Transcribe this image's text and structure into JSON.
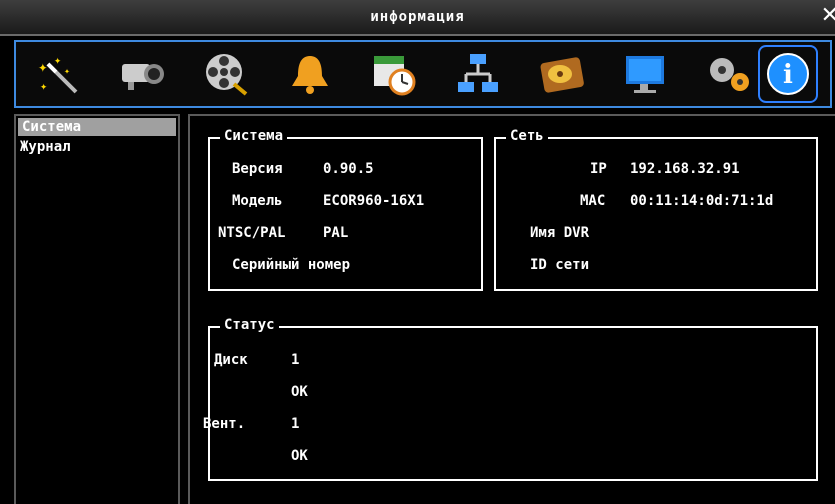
{
  "window": {
    "title": "информация"
  },
  "toolbar": {
    "icons": [
      "wizard-icon",
      "camera-icon",
      "film-reel-icon",
      "alarm-bell-icon",
      "schedule-icon",
      "network-icon",
      "hdd-icon",
      "monitor-icon",
      "settings-gears-icon",
      "info-icon"
    ],
    "selected": "info-icon"
  },
  "leftnav": {
    "items": [
      {
        "label": "Система",
        "active": true
      },
      {
        "label": "Журнал",
        "active": false
      }
    ]
  },
  "system_group": {
    "title": "Система",
    "version_label": "Версия",
    "version_value": "0.90.5",
    "model_label": "Модель",
    "model_value": "ECOR960-16X1",
    "ntscpal_label": "NTSC/PAL",
    "ntscpal_value": "PAL",
    "serial_label": "Серийный номер"
  },
  "network_group": {
    "title": "Сеть",
    "ip_label": "IP",
    "ip_value": "192.168.32.91",
    "mac_label": "MAC",
    "mac_value": "00:11:14:0d:71:1d",
    "dvrname_label": "Имя DVR",
    "netid_label": "ID сети"
  },
  "status_group": {
    "title": "Статус",
    "disk_label": "Диск",
    "disk_num": "1",
    "disk_state": "OK",
    "fan_label": "Вент.",
    "fan_num": "1",
    "fan_state": "OK"
  },
  "colors": {
    "accent": "#2f80ff",
    "panel_border": "#ffffff",
    "nav_active": "#a0a0a0"
  }
}
